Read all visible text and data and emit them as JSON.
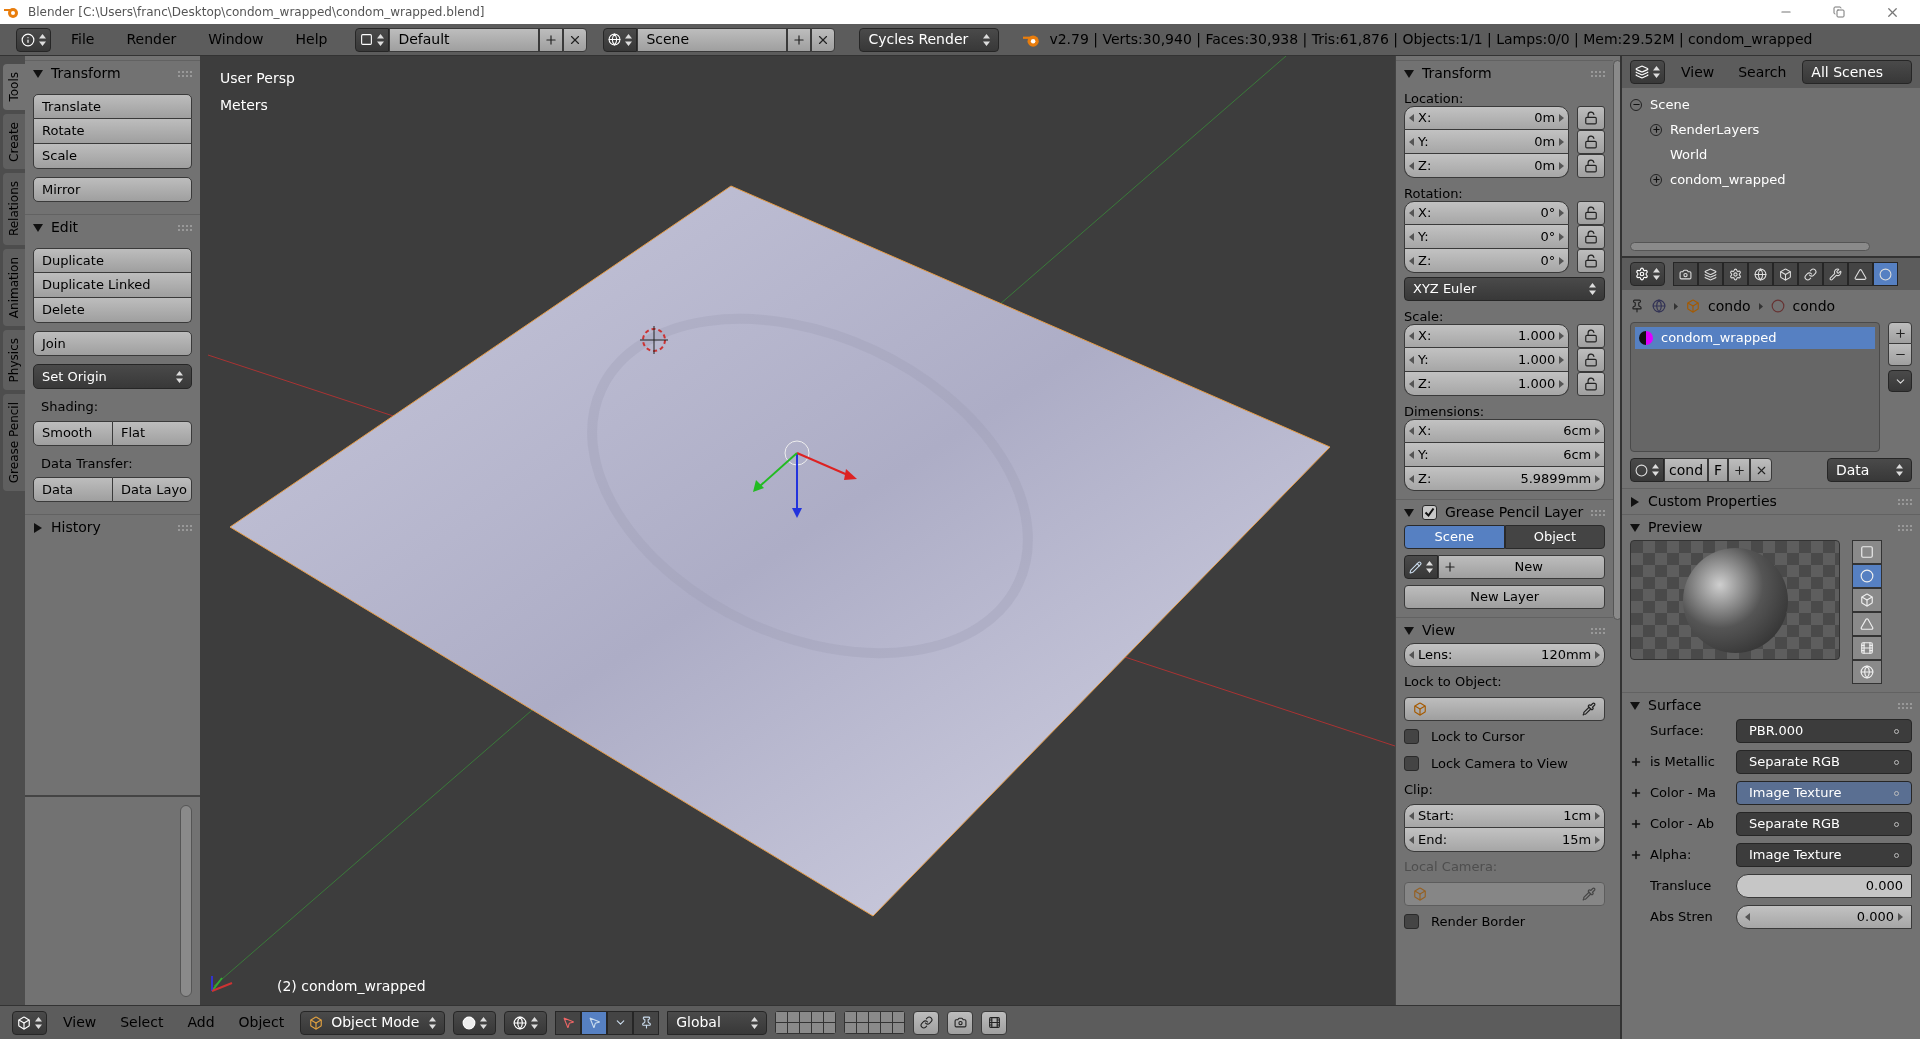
{
  "title_bar": {
    "title": "Blender [C:\\Users\\franc\\Desktop\\condom_wrapped\\condom_wrapped.blend]"
  },
  "info_header": {
    "menus": [
      "File",
      "Render",
      "Window",
      "Help"
    ],
    "layout": "Default",
    "scene": "Scene",
    "engine": "Cycles Render",
    "stats": "v2.79 | Verts:30,940 | Faces:30,938 | Tris:61,876 | Objects:1/1 | Lamps:0/0 | Mem:29.52M | condom_wrapped"
  },
  "tool_tabs": [
    {
      "label": "Tools",
      "selected": true
    },
    {
      "label": "Create",
      "selected": false
    },
    {
      "label": "Relations",
      "selected": false
    },
    {
      "label": "Animation",
      "selected": false
    },
    {
      "label": "Physics",
      "selected": false
    },
    {
      "label": "Grease Pencil",
      "selected": false
    }
  ],
  "tool_shelf": [
    {
      "title": "Transform",
      "expanded": true,
      "items": [
        {
          "kind": "column",
          "buttons": [
            "Translate",
            "Rotate",
            "Scale"
          ]
        },
        {
          "kind": "column",
          "buttons": [
            "Mirror"
          ]
        }
      ]
    },
    {
      "title": "Edit",
      "expanded": true,
      "items": [
        {
          "kind": "column",
          "buttons": [
            "Duplicate",
            "Duplicate Linked",
            "Delete"
          ]
        },
        {
          "kind": "column",
          "buttons": [
            "Join"
          ]
        },
        {
          "kind": "dropdown",
          "text": "Set Origin"
        },
        {
          "kind": "label",
          "text": "Shading:"
        },
        {
          "kind": "row",
          "buttons": [
            "Smooth",
            "Flat"
          ]
        },
        {
          "kind": "label",
          "text": "Data Transfer:"
        },
        {
          "kind": "row",
          "buttons": [
            "Data",
            "Data Layo"
          ]
        }
      ]
    },
    {
      "title": "History",
      "expanded": false
    }
  ],
  "viewport": {
    "view_name": "User Persp",
    "units": "Meters",
    "object_label": "(2) condom_wrapped"
  },
  "n_panel": {
    "transform": {
      "title": "Transform",
      "groups": [
        {
          "label": "Location:",
          "lockable": true,
          "fields": [
            {
              "axis": "X:",
              "value": "0m"
            },
            {
              "axis": "Y:",
              "value": "0m"
            },
            {
              "axis": "Z:",
              "value": "0m"
            }
          ]
        },
        {
          "label": "Rotation:",
          "lockable": true,
          "fields": [
            {
              "axis": "X:",
              "value": "0°"
            },
            {
              "axis": "Y:",
              "value": "0°"
            },
            {
              "axis": "Z:",
              "value": "0°"
            }
          ],
          "mode": "XYZ Euler"
        },
        {
          "label": "Scale:",
          "lockable": true,
          "fields": [
            {
              "axis": "X:",
              "value": "1.000"
            },
            {
              "axis": "Y:",
              "value": "1.000"
            },
            {
              "axis": "Z:",
              "value": "1.000"
            }
          ]
        },
        {
          "label": "Dimensions:",
          "lockable": false,
          "fields": [
            {
              "axis": "X:",
              "value": "6cm"
            },
            {
              "axis": "Y:",
              "value": "6cm"
            },
            {
              "axis": "Z:",
              "value": "5.9899mm"
            }
          ]
        }
      ]
    },
    "grease_pencil": {
      "title": "Grease Pencil Layer",
      "checked": true,
      "toggles": [
        {
          "label": "Scene",
          "selected": true
        },
        {
          "label": "Object",
          "selected": false
        }
      ],
      "new": "New",
      "new_layer": "New Layer"
    },
    "view": {
      "title": "View",
      "lens": {
        "label": "Lens:",
        "value": "120mm"
      },
      "lock_label": "Lock to Object:",
      "checks": [
        {
          "label": "Lock to Cursor",
          "checked": false
        },
        {
          "label": "Lock Camera to View",
          "checked": false
        }
      ],
      "clip_label": "Clip:",
      "clip": [
        {
          "label": "Start:",
          "value": "1cm"
        },
        {
          "label": "End:",
          "value": "15m"
        }
      ],
      "local_camera": {
        "label": "Local Camera:",
        "disabled": true
      },
      "render_border": {
        "label": "Render Border",
        "checked": false
      }
    }
  },
  "outliner": {
    "menus": [
      "View",
      "Search"
    ],
    "filter": "All Scenes",
    "tree": [
      {
        "name": "Scene",
        "expanded": true,
        "children": [
          {
            "name": "RenderLayers",
            "expanded": false
          },
          {
            "name": "World"
          },
          {
            "name": "condom_wrapped",
            "expanded": false
          }
        ]
      }
    ]
  },
  "properties": {
    "tabs": [
      {
        "selected": false
      },
      {
        "selected": false
      },
      {
        "selected": false
      },
      {
        "selected": false
      },
      {
        "selected": false
      },
      {
        "selected": false
      },
      {
        "selected": false
      },
      {
        "selected": false
      },
      {
        "selected": true
      }
    ],
    "breadcrumb": [
      "condo",
      "condo"
    ],
    "slots": [
      {
        "name": "condom_wrapped",
        "selected": true
      }
    ],
    "id_block": {
      "name": "cond",
      "fake_user": "F",
      "link": "Data"
    },
    "panels": [
      {
        "title": "Custom Properties",
        "expanded": false
      },
      {
        "kind": "preview",
        "title": "Preview",
        "expanded": true,
        "shapes": [
          {
            "selected": false
          },
          {
            "selected": true
          },
          {
            "selected": false
          },
          {
            "selected": false
          },
          {
            "selected": false
          },
          {
            "selected": false
          }
        ]
      },
      {
        "kind": "surface",
        "title": "Surface",
        "expanded": true,
        "rows": [
          {
            "kind": "link",
            "label": "Surface:",
            "value": "PBR.000",
            "socket": false,
            "highlighted": false
          },
          {
            "kind": "link",
            "label": "is Metallic",
            "value": "Separate RGB",
            "socket": true,
            "highlighted": false
          },
          {
            "kind": "link",
            "label": "Color - Ma",
            "value": "Image Texture",
            "socket": true,
            "highlighted": true
          },
          {
            "kind": "link",
            "label": "Color - Ab",
            "value": "Separate RGB",
            "socket": true,
            "highlighted": false
          },
          {
            "kind": "link",
            "label": "Alpha:",
            "value": "Image Texture",
            "socket": true,
            "highlighted": false
          },
          {
            "kind": "slider",
            "label": "Transluce",
            "value": "0.000"
          },
          {
            "kind": "number",
            "label": "Abs Stren",
            "value": "0.000"
          }
        ]
      }
    ]
  },
  "bottom_header": {
    "menus": [
      "View",
      "Select",
      "Add",
      "Object"
    ],
    "mode": "Object Mode",
    "manipulators": [
      {
        "selected": false
      },
      {
        "selected": true
      },
      {
        "selected": false
      },
      {
        "selected": false
      }
    ],
    "orientation": "Global"
  }
}
